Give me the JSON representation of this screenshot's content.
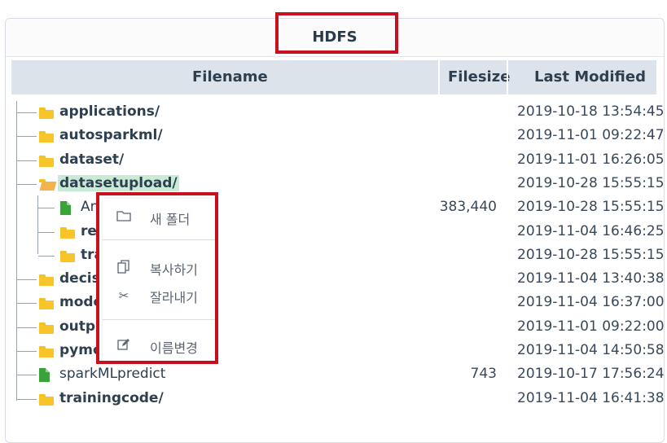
{
  "panel": {
    "title": "HDFS"
  },
  "table": {
    "headers": {
      "filename": "Filename",
      "filesize": "Filesize",
      "last_modified": "Last Modified"
    }
  },
  "rows": [
    {
      "name": "applications/",
      "type": "folder",
      "size": "",
      "modified": "2019-10-18 13:54:45"
    },
    {
      "name": "autosparkml/",
      "type": "folder",
      "size": "",
      "modified": "2019-11-01 09:22:47"
    },
    {
      "name": "dataset/",
      "type": "folder",
      "size": "",
      "modified": "2019-11-01 16:26:05"
    },
    {
      "name": "datasetupload/",
      "type": "folder-open",
      "size": "",
      "modified": "2019-10-28 15:55:15",
      "selected": true
    },
    {
      "name": "An",
      "type": "file",
      "size": "383,440",
      "modified": "2019-10-28 15:55:15",
      "child": true
    },
    {
      "name": "re",
      "type": "folder",
      "size": "",
      "modified": "2019-11-04 16:46:25",
      "child": true
    },
    {
      "name": "tra",
      "type": "folder",
      "size": "",
      "modified": "2019-10-28 15:55:15",
      "child": true
    },
    {
      "name": "decis",
      "type": "folder",
      "size": "",
      "modified": "2019-11-04 13:40:38"
    },
    {
      "name": "mode",
      "type": "folder",
      "size": "",
      "modified": "2019-11-04 16:37:00"
    },
    {
      "name": "outpu",
      "type": "folder",
      "size": "",
      "modified": "2019-11-01 09:22:00"
    },
    {
      "name": "pymo",
      "type": "folder",
      "size": "",
      "modified": "2019-11-04 14:50:58"
    },
    {
      "name": "sparkMLpredict",
      "type": "file",
      "size": "743",
      "modified": "2019-10-17 17:56:24"
    },
    {
      "name": "trainingcode/",
      "type": "folder",
      "size": "",
      "modified": "2019-11-04 16:41:38"
    }
  ],
  "context_menu": {
    "items": [
      {
        "label": "새 폴더",
        "icon": "folder-outline-icon"
      },
      {
        "label": "복사하기",
        "icon": "copy-icon"
      },
      {
        "label": "잘라내기",
        "icon": "scissors-icon"
      },
      {
        "label": "이름변경",
        "icon": "edit-icon"
      }
    ]
  },
  "colors": {
    "highlight": "#c8101e",
    "header_bg": "#dde3ea",
    "folder": "#f7c52a",
    "file": "#3aa23a",
    "selected_bg": "#c9ead6"
  }
}
